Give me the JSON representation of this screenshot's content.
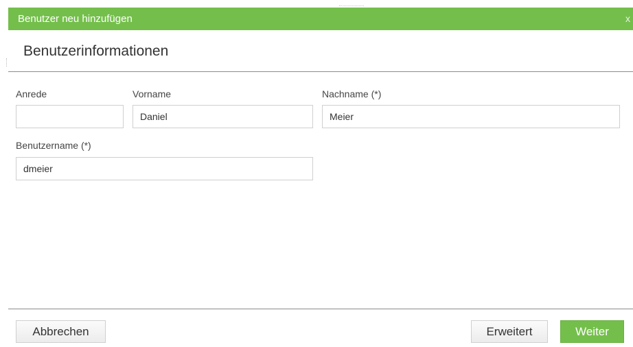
{
  "dialog": {
    "title": "Benutzer neu hinzufügen",
    "close_label": "x"
  },
  "section": {
    "title": "Benutzerinformationen"
  },
  "form": {
    "salutation": {
      "label": "Anrede",
      "value": ""
    },
    "first_name": {
      "label": "Vorname",
      "value": "Daniel"
    },
    "last_name": {
      "label": "Nachname (*)",
      "value": "Meier"
    },
    "username": {
      "label": "Benutzername (*)",
      "value": "dmeier"
    }
  },
  "footer": {
    "cancel_label": "Abbrechen",
    "advanced_label": "Erweitert",
    "next_label": "Weiter"
  },
  "colors": {
    "accent": "#74bf4b",
    "title_text": "#ffffff",
    "border": "#cfcfcf"
  }
}
